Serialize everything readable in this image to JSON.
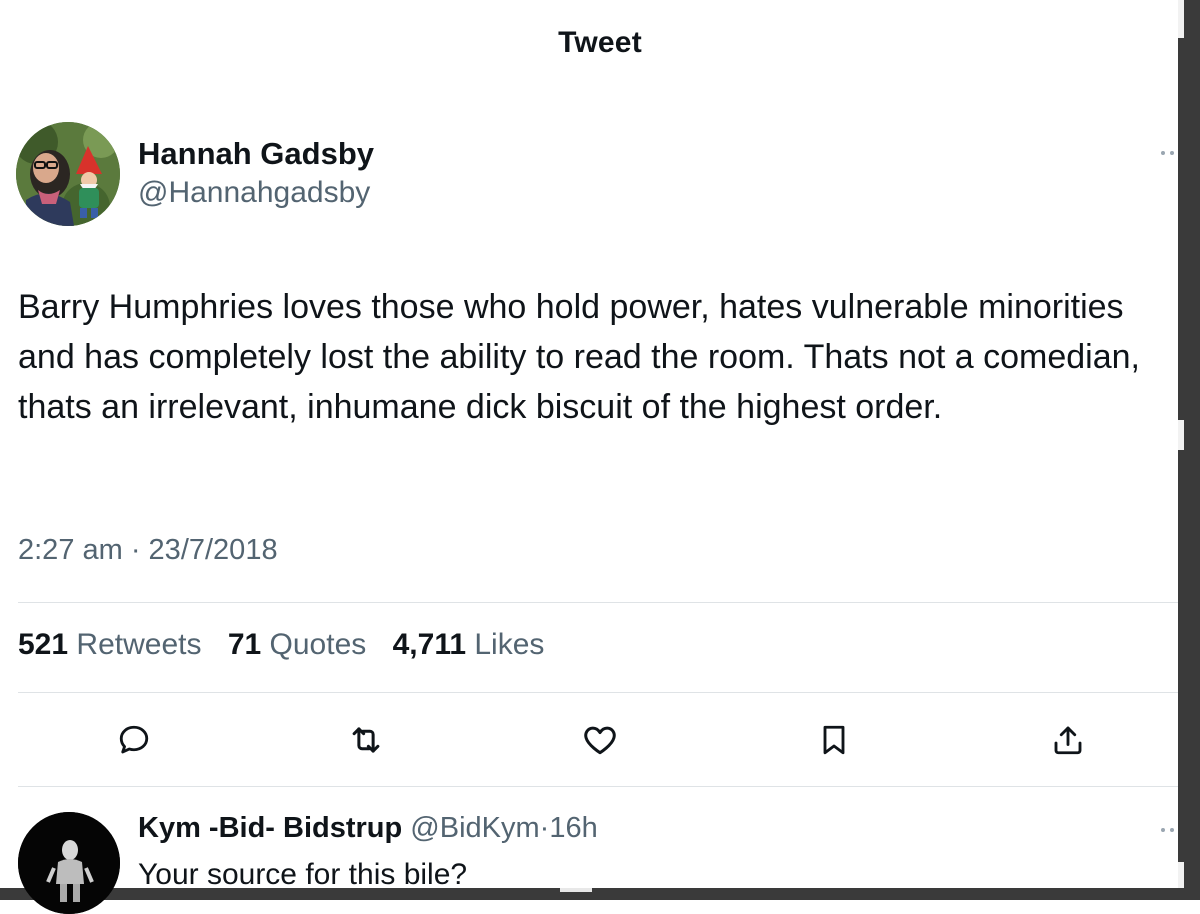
{
  "header": {
    "title": "Tweet"
  },
  "tweet": {
    "author_name": "Hannah Gadsby",
    "author_handle": "@Hannahgadsby",
    "avatar_icon": "profile-photo-avatar",
    "text": "Barry Humphries loves those who hold power, hates vulnerable minorities and has completely lost the ability to read the room.  Thats not a comedian, thats an irrelevant, inhumane dick biscuit of the highest order.",
    "timestamp": "2:27 am · 23/7/2018",
    "stats": {
      "retweets_count": "521",
      "retweets_label": "Retweets",
      "quotes_count": "71",
      "quotes_label": "Quotes",
      "likes_count": "4,711",
      "likes_label": "Likes"
    },
    "actions": [
      {
        "name": "reply",
        "icon": "speech-bubble-icon"
      },
      {
        "name": "retweet",
        "icon": "retweet-arrows-icon"
      },
      {
        "name": "like",
        "icon": "heart-icon"
      },
      {
        "name": "bookmark",
        "icon": "bookmark-icon"
      },
      {
        "name": "share",
        "icon": "share-upload-icon"
      }
    ]
  },
  "reply": {
    "author_name": "Kym -Bid- Bidstrup",
    "author_handle": "@BidKym",
    "separator": "·",
    "time": "16h",
    "text": "Your source for this bile?"
  },
  "colors": {
    "primary_text": "#0f1419",
    "secondary_text": "#536471",
    "divider": "#dfe3e6",
    "background": "#ffffff"
  }
}
